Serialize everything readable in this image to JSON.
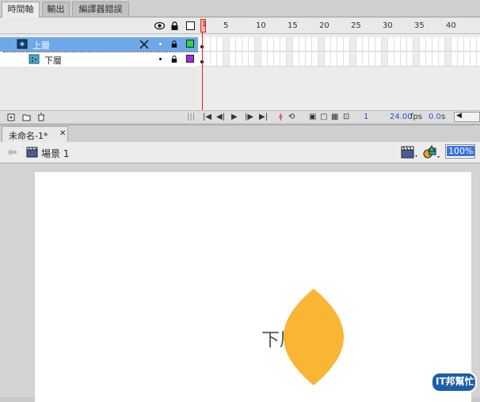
{
  "panel_tabs": [
    "時間軸",
    "輸出",
    "編譯器錯誤"
  ],
  "layers": [
    {
      "name": "上層",
      "color": "#2fd840",
      "selected": true
    },
    {
      "name": "下層",
      "color": "#a030d8",
      "selected": false
    }
  ],
  "ruler": {
    "labels": [
      "1",
      "5",
      "10",
      "15",
      "20",
      "25",
      "30",
      "35",
      "40"
    ]
  },
  "timeline_footer": {
    "current_frame": "1",
    "frame_rate": "24.00",
    "fps_unit": "fps",
    "elapsed": "0.0",
    "elapsed_unit": "s"
  },
  "document": {
    "tab_label": "未命名-1*",
    "close_symbol": "✕"
  },
  "edit_bar": {
    "scene_label": "場景 1",
    "zoom_value": "100%"
  },
  "stage": {
    "shape_text": "下層",
    "shape_color": "#f9b534"
  },
  "watermark": {
    "text": "IT邦幫忙"
  },
  "colors": {
    "selection": "#6fa8e8",
    "playhead": "#dd2222",
    "accent_text": "#2655c9"
  }
}
